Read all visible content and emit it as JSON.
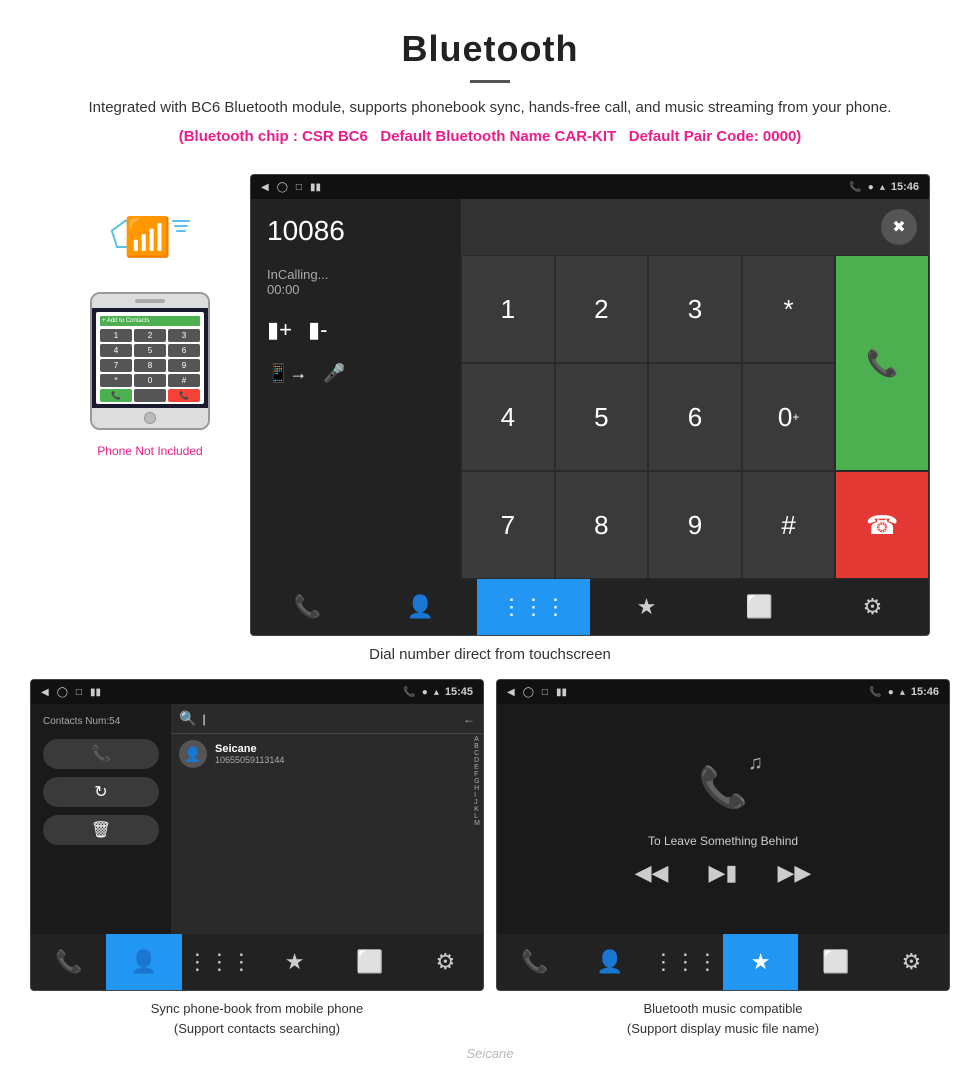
{
  "header": {
    "title": "Bluetooth",
    "description": "Integrated with BC6 Bluetooth module, supports phonebook sync, hands-free call, and music streaming from your phone.",
    "info_chip": "(Bluetooth chip : CSR BC6    Default Bluetooth Name CAR-KIT    Default Pair Code: 0000)",
    "info_parts": {
      "chip": "(Bluetooth chip : CSR BC6",
      "name": "Default Bluetooth Name CAR-KIT",
      "code": "Default Pair Code: 0000)"
    }
  },
  "phone_aside": {
    "not_included": "Phone Not Included"
  },
  "dial_screen": {
    "status_bar": {
      "time": "15:46"
    },
    "number": "10086",
    "calling_label": "InCalling...",
    "timer": "00:00",
    "caption": "Dial number direct from touchscreen",
    "numpad": [
      "1",
      "2",
      "3",
      "*",
      "4",
      "5",
      "6",
      "0+",
      "7",
      "8",
      "9",
      "#"
    ]
  },
  "contacts_screen": {
    "status_bar": {
      "time": "15:45"
    },
    "contacts_num_label": "Contacts Num:54",
    "search_placeholder": "Search",
    "contact": {
      "name": "Seicane",
      "phone": "10655059113144"
    },
    "alphabet": [
      "A",
      "B",
      "C",
      "D",
      "E",
      "F",
      "G",
      "H",
      "I",
      "J",
      "K",
      "L",
      "M"
    ],
    "caption_line1": "Sync phone-book from mobile phone",
    "caption_line2": "(Support contacts searching)"
  },
  "music_screen": {
    "status_bar": {
      "time": "15:46"
    },
    "song_title": "To Leave Something Behind",
    "caption_line1": "Bluetooth music compatible",
    "caption_line2": "(Support display music file name)"
  },
  "watermark": "Seicane",
  "tab_bar": {
    "items": [
      "phone-icon",
      "contacts-icon",
      "grid-icon",
      "bluetooth-icon",
      "transfer-icon",
      "settings-icon"
    ]
  }
}
